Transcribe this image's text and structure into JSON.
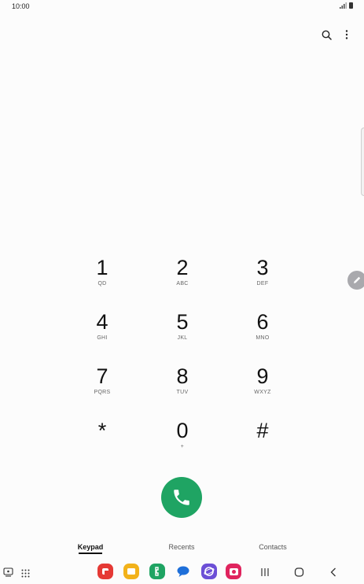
{
  "status": {
    "time": "10:00"
  },
  "keypad": {
    "keys": [
      {
        "digit": "1",
        "sub": "QD"
      },
      {
        "digit": "2",
        "sub": "ABC"
      },
      {
        "digit": "3",
        "sub": "DEF"
      },
      {
        "digit": "4",
        "sub": "GHI"
      },
      {
        "digit": "5",
        "sub": "JKL"
      },
      {
        "digit": "6",
        "sub": "MNO"
      },
      {
        "digit": "7",
        "sub": "PQRS"
      },
      {
        "digit": "8",
        "sub": "TUV"
      },
      {
        "digit": "9",
        "sub": "WXYZ"
      },
      {
        "digit": "*",
        "sub": ""
      },
      {
        "digit": "0",
        "sub": "+"
      },
      {
        "digit": "#",
        "sub": ""
      }
    ]
  },
  "tabs": [
    {
      "label": "Keypad",
      "active": true
    },
    {
      "label": "Recents",
      "active": false
    },
    {
      "label": "Contacts",
      "active": false
    }
  ],
  "colors": {
    "call": "#1fa463",
    "background": "#fcfcfc"
  },
  "icons": [
    "search-icon",
    "more-options-icon",
    "pencil-icon",
    "phone-icon",
    "recent-apps-icon",
    "home-icon",
    "back-icon"
  ]
}
